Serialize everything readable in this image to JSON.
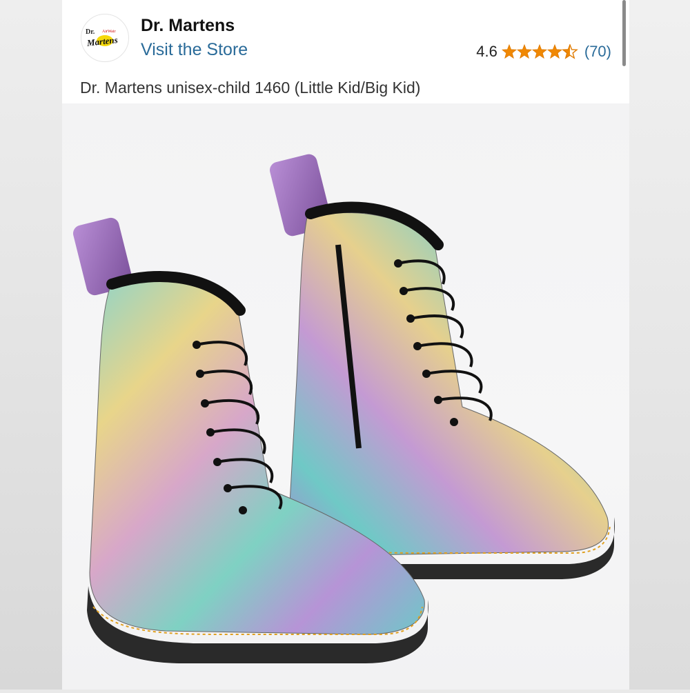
{
  "seller": {
    "name": "Dr. Martens",
    "logo_text": "Dr. AirWair Martens",
    "visit_store_label": "Visit the Store"
  },
  "rating": {
    "value": "4.6",
    "stars": 4.5,
    "review_count": "(70)",
    "star_color": "#f08804"
  },
  "product": {
    "title": "Dr. Martens unisex-child 1460 (Little Kid/Big Kid)",
    "image_icon": "rainbow-boots-image"
  },
  "colors": {
    "link": "#2a6b99",
    "text": "#111111"
  }
}
